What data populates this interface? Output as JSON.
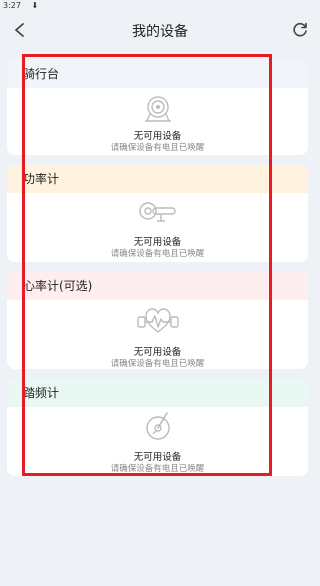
{
  "status": {
    "time": "3:27"
  },
  "header": {
    "title": "我的设备",
    "back_icon": "back-arrow-icon",
    "refresh_icon": "refresh-icon"
  },
  "colors": {
    "trainer_head": "#f1f4f8",
    "power_head": "#fff3e0",
    "heart_head": "#ffeef0",
    "cadence_head": "#e9f8f3",
    "highlight": "#e51c23"
  },
  "sections": [
    {
      "title": "骑行台",
      "empty_title": "无可用设备",
      "empty_sub": "请确保设备有电且已唤醒",
      "icon": "trainer-icon"
    },
    {
      "title": "功率计",
      "empty_title": "无可用设备",
      "empty_sub": "请确保设备有电且已唤醒",
      "icon": "power-meter-icon"
    },
    {
      "title": "心率计(可选)",
      "empty_title": "无可用设备",
      "empty_sub": "请确保设备有电且已唤醒",
      "icon": "heart-rate-icon"
    },
    {
      "title": "踏频计",
      "empty_title": "无可用设备",
      "empty_sub": "请确保设备有电且已唤醒",
      "icon": "cadence-icon"
    }
  ]
}
